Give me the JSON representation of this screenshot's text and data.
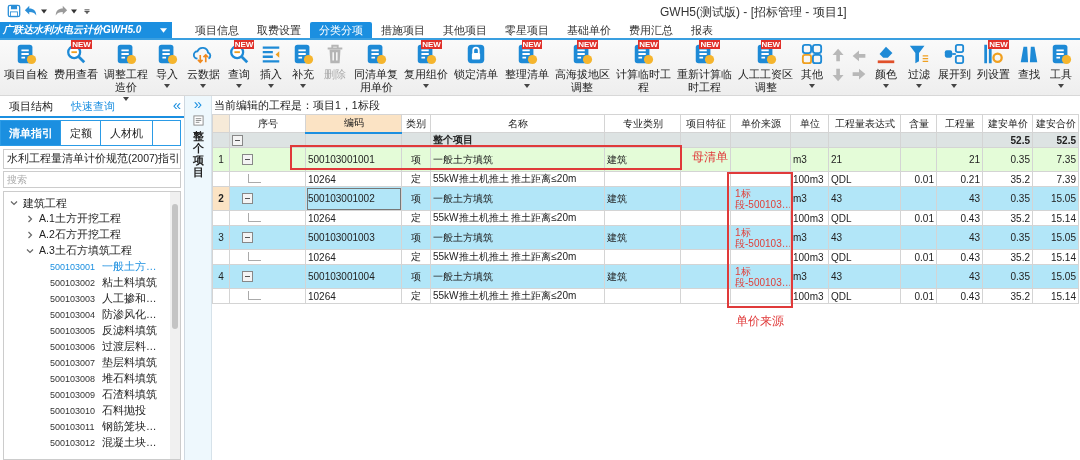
{
  "title_bar": {
    "title": "GWH5(测试版) - [招标管理 - 项目1]"
  },
  "app_menu": {
    "label": "广联达水利水电云计价GWH5.0"
  },
  "tabs": [
    {
      "label": "项目信息",
      "selected": false
    },
    {
      "label": "取费设置",
      "selected": false
    },
    {
      "label": "分类分项",
      "selected": true
    },
    {
      "label": "措施项目",
      "selected": false
    },
    {
      "label": "其他项目",
      "selected": false
    },
    {
      "label": "零星项目",
      "selected": false
    },
    {
      "label": "基础单价",
      "selected": false
    },
    {
      "label": "费用汇总",
      "selected": false
    },
    {
      "label": "报表",
      "selected": false
    }
  ],
  "ribbon": [
    {
      "kind": "button",
      "lines": [
        "项目自检"
      ],
      "dropdown": false,
      "disabled": false
    },
    {
      "kind": "button",
      "lines": [
        "费用查看"
      ],
      "badge": "NEW",
      "dropdown": false,
      "disabled": false
    },
    {
      "kind": "button",
      "lines": [
        "调整工程",
        "造价"
      ],
      "dropdown": true,
      "disabled": false
    },
    {
      "kind": "button",
      "lines": [
        "导入"
      ],
      "dropdown": true,
      "disabled": false
    },
    {
      "kind": "button",
      "lines": [
        "云数据"
      ],
      "dropdown": true,
      "disabled": false
    },
    {
      "kind": "button",
      "lines": [
        "查询"
      ],
      "badge": "NEW",
      "dropdown": true,
      "disabled": false
    },
    {
      "kind": "button",
      "lines": [
        "插入"
      ],
      "dropdown": true,
      "disabled": false
    },
    {
      "kind": "button",
      "lines": [
        "补充"
      ],
      "dropdown": true,
      "disabled": false
    },
    {
      "kind": "button",
      "lines": [
        "删除"
      ],
      "dropdown": false,
      "disabled": true
    },
    {
      "kind": "button",
      "lines": [
        "同清单复",
        "用单价"
      ],
      "dropdown": false,
      "disabled": false
    },
    {
      "kind": "button",
      "lines": [
        "复用组价"
      ],
      "badge": "NEW",
      "dropdown": true,
      "disabled": false
    },
    {
      "kind": "button",
      "lines": [
        "锁定清单"
      ],
      "dropdown": false,
      "disabled": false
    },
    {
      "kind": "button",
      "lines": [
        "整理清单"
      ],
      "badge": "NEW",
      "dropdown": true,
      "disabled": false
    },
    {
      "kind": "button",
      "lines": [
        "高海拔地区",
        "调整"
      ],
      "badge": "NEW",
      "dropdown": false,
      "disabled": false
    },
    {
      "kind": "button",
      "lines": [
        "计算临时工",
        "程"
      ],
      "badge": "NEW",
      "dropdown": false,
      "disabled": false
    },
    {
      "kind": "button",
      "lines": [
        "重新计算临",
        "时工程"
      ],
      "badge": "NEW",
      "dropdown": false,
      "disabled": false
    },
    {
      "kind": "button",
      "lines": [
        "人工工资区",
        "调整"
      ],
      "badge": "NEW",
      "dropdown": false,
      "disabled": false
    },
    {
      "kind": "button",
      "lines": [
        "其他"
      ],
      "dropdown": true,
      "disabled": false
    },
    {
      "kind": "arrows",
      "disabled": true
    },
    {
      "kind": "button",
      "lines": [
        "颜色"
      ],
      "dropdown": true,
      "disabled": false
    },
    {
      "kind": "button",
      "lines": [
        "过滤"
      ],
      "dropdown": true,
      "disabled": false
    },
    {
      "kind": "button",
      "lines": [
        "展开到"
      ],
      "dropdown": true,
      "disabled": false
    },
    {
      "kind": "button",
      "lines": [
        "列设置"
      ],
      "badge": "NEW",
      "dropdown": false,
      "disabled": false
    },
    {
      "kind": "button",
      "lines": [
        "查找"
      ],
      "dropdown": false,
      "disabled": false
    },
    {
      "kind": "button",
      "lines": [
        "工具"
      ],
      "dropdown": true,
      "disabled": false
    }
  ],
  "left_panel": {
    "collapse": "«",
    "tabs": [
      {
        "label": "项目结构",
        "selected": false
      },
      {
        "label": "快速查询",
        "selected": true
      }
    ],
    "subtabs": [
      {
        "label": "清单指引",
        "selected": true
      },
      {
        "label": "定额",
        "selected": false
      },
      {
        "label": "人材机",
        "selected": false
      }
    ],
    "guide_select": {
      "value": "水利工程量清单计价规范(2007)指引"
    },
    "search": {
      "placeholder": "搜索"
    },
    "tree": [
      {
        "label": "建筑工程",
        "expanded": true,
        "children": [
          {
            "label": "A.1土方开挖工程",
            "expanded": false
          },
          {
            "label": "A.2石方开挖工程",
            "expanded": false
          },
          {
            "label": "A.3土石方填筑工程",
            "expanded": true,
            "children": [
              {
                "code": "500103001",
                "name": "一般土方…",
                "selected": true
              },
              {
                "code": "500103002",
                "name": "粘土料填筑",
                "selected": false
              },
              {
                "code": "500103003",
                "name": "人工掺和…",
                "selected": false
              },
              {
                "code": "500103004",
                "name": "防渗风化…",
                "selected": false
              },
              {
                "code": "500103005",
                "name": "反滤料填筑",
                "selected": false
              },
              {
                "code": "500103006",
                "name": "过渡层料…",
                "selected": false
              },
              {
                "code": "500103007",
                "name": "垫层料填筑",
                "selected": false
              },
              {
                "code": "500103008",
                "name": "堆石料填筑",
                "selected": false
              },
              {
                "code": "500103009",
                "name": "石渣料填筑",
                "selected": false
              },
              {
                "code": "500103010",
                "name": "石料抛投",
                "selected": false
              },
              {
                "code": "500103011",
                "name": "钢筋笼块…",
                "selected": false
              },
              {
                "code": "500103012",
                "name": "混凝土块…",
                "selected": false
              }
            ]
          }
        ]
      }
    ]
  },
  "side_strip": {
    "expand": "»",
    "label": "整个项目"
  },
  "editing_note": "当前编辑的工程是：项目1，1标段",
  "table": {
    "columns": [
      {
        "label": "序号",
        "selected": false
      },
      {
        "label": "编码",
        "selected": true
      },
      {
        "label": "类别",
        "selected": false
      },
      {
        "label": "名称",
        "selected": false
      },
      {
        "label": "专业类别",
        "selected": false
      },
      {
        "label": "项目特征",
        "selected": false
      },
      {
        "label": "单价来源",
        "selected": false
      },
      {
        "label": "单位",
        "selected": false
      },
      {
        "label": "工程量表达式",
        "selected": false
      },
      {
        "label": "含量",
        "selected": false
      },
      {
        "label": "工程量",
        "selected": false
      },
      {
        "label": "建安单价",
        "selected": false
      },
      {
        "label": "建安合价",
        "selected": false
      }
    ],
    "rows": [
      {
        "kind": "total",
        "name": "整个项目",
        "unit_price": "52.5",
        "total_price": "52.5",
        "expanded": true,
        "selected": false
      },
      {
        "kind": "bill",
        "seq": "1",
        "code": "500103001001",
        "type": "项",
        "name": "一般土方填筑",
        "specialty": "建筑",
        "unit": "m3",
        "expression": "21",
        "quantity": "21",
        "unit_price": "0.35",
        "total_price": "7.35",
        "color": "#e4fcd8",
        "expanded": true,
        "selected": false
      },
      {
        "kind": "quota",
        "code": "10264",
        "type": "定",
        "name": "55kW推土机推土 推土距离≤20m",
        "unit": "100m3",
        "expression": "QDL",
        "content": "0.01",
        "quantity": "0.21",
        "unit_price": "35.2",
        "total_price": "7.39",
        "selected": false
      },
      {
        "kind": "bill",
        "seq": "2",
        "code": "500103001002",
        "type": "项",
        "name": "一般土方填筑",
        "specialty": "建筑",
        "price_source": "1标段-500103…",
        "unit": "m3",
        "expression": "43",
        "quantity": "43",
        "unit_price": "0.35",
        "total_price": "15.05",
        "color": "#b2e6f8",
        "expanded": true,
        "selected": true
      },
      {
        "kind": "quota",
        "code": "10264",
        "type": "定",
        "name": "55kW推土机推土 推土距离≤20m",
        "unit": "100m3",
        "expression": "QDL",
        "content": "0.01",
        "quantity": "0.43",
        "unit_price": "35.2",
        "total_price": "15.14",
        "selected": false
      },
      {
        "kind": "bill",
        "seq": "3",
        "code": "500103001003",
        "type": "项",
        "name": "一般土方填筑",
        "specialty": "建筑",
        "price_source": "1标段-500103…",
        "unit": "m3",
        "expression": "43",
        "quantity": "43",
        "unit_price": "0.35",
        "total_price": "15.05",
        "color": "#b2e6f8",
        "expanded": true,
        "selected": false
      },
      {
        "kind": "quota",
        "code": "10264",
        "type": "定",
        "name": "55kW推土机推土 推土距离≤20m",
        "unit": "100m3",
        "expression": "QDL",
        "content": "0.01",
        "quantity": "0.43",
        "unit_price": "35.2",
        "total_price": "15.14",
        "selected": false
      },
      {
        "kind": "bill",
        "seq": "4",
        "code": "500103001004",
        "type": "项",
        "name": "一般土方填筑",
        "specialty": "建筑",
        "price_source": "1标段-500103…",
        "unit": "m3",
        "expression": "43",
        "quantity": "43",
        "unit_price": "0.35",
        "total_price": "15.05",
        "color": "#b2e6f8",
        "expanded": true,
        "selected": false
      },
      {
        "kind": "quota",
        "code": "10264",
        "type": "定",
        "name": "55kW推土机推土 推土距离≤20m",
        "unit": "100m3",
        "expression": "QDL",
        "content": "0.01",
        "quantity": "0.43",
        "unit_price": "35.2",
        "total_price": "15.14",
        "selected": false
      }
    ]
  },
  "annotations": [
    {
      "text": "母清单"
    },
    {
      "text": "单价来源"
    }
  ]
}
